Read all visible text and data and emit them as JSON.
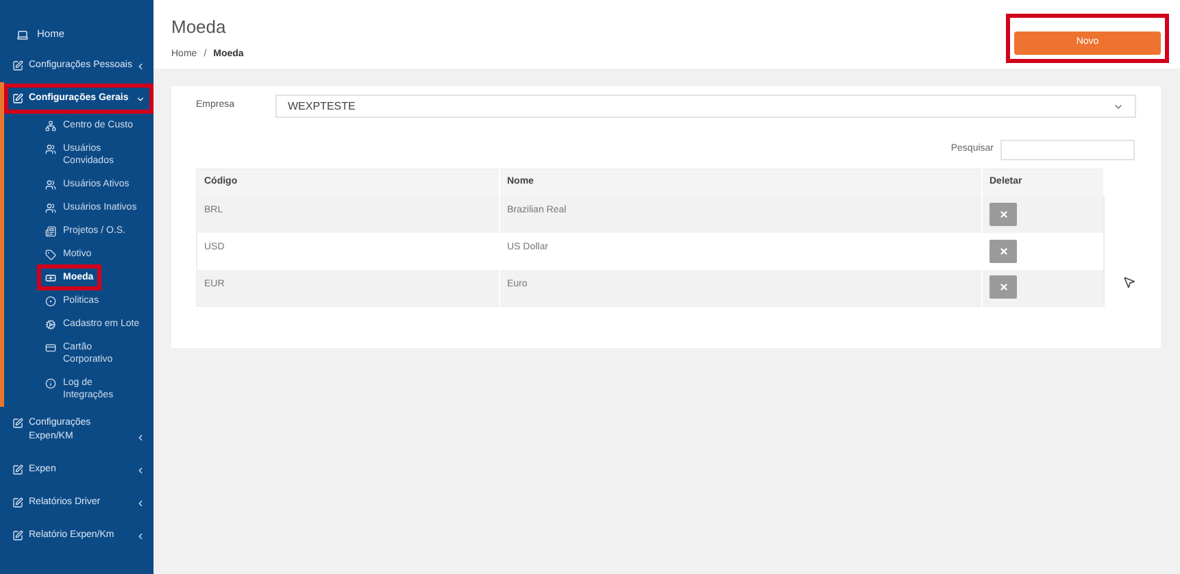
{
  "sidebar": {
    "items": [
      {
        "label": "Home",
        "kind": "link"
      },
      {
        "label": "Configurações Pessoais",
        "kind": "group",
        "expanded": false,
        "highlighted": false
      },
      {
        "label": "Configurações Gerais",
        "kind": "group",
        "expanded": true,
        "highlighted": true,
        "children": [
          {
            "label": "Centro de Custo",
            "selected": false,
            "highlighted": false
          },
          {
            "label": "Usuários Convidados",
            "selected": false,
            "highlighted": false
          },
          {
            "label": "Usuários Ativos",
            "selected": false,
            "highlighted": false
          },
          {
            "label": "Usuários Inativos",
            "selected": false,
            "highlighted": false
          },
          {
            "label": "Projetos / O.S.",
            "selected": false,
            "highlighted": false
          },
          {
            "label": "Motivo",
            "selected": false,
            "highlighted": false
          },
          {
            "label": "Moeda",
            "selected": true,
            "highlighted": true
          },
          {
            "label": "Politicas",
            "selected": false,
            "highlighted": false
          },
          {
            "label": "Cadastro em Lote",
            "selected": false,
            "highlighted": false
          },
          {
            "label": "Cartão Corporativo",
            "selected": false,
            "highlighted": false
          },
          {
            "label": "Log de Integrações",
            "selected": false,
            "highlighted": false
          }
        ]
      },
      {
        "label": "Configurações Expen/KM",
        "kind": "group",
        "expanded": false,
        "highlighted": false
      },
      {
        "label": "Expen",
        "kind": "group",
        "expanded": false,
        "highlighted": false
      },
      {
        "label": "Relatórios Driver",
        "kind": "group",
        "expanded": false,
        "highlighted": false
      },
      {
        "label": "Relatório Expen/Km",
        "kind": "group",
        "expanded": false,
        "highlighted": false
      }
    ]
  },
  "header": {
    "title": "Moeda",
    "breadcrumb": [
      "Home",
      "Moeda"
    ],
    "separator": "/",
    "new_button": {
      "label": "Novo",
      "highlighted": true
    }
  },
  "form": {
    "label": "Empresa",
    "value": "WEXPTESTE"
  },
  "search": {
    "label": "Pesquisar"
  },
  "table": {
    "columns": [
      "Código",
      "Nome",
      "Deletar"
    ],
    "rows": [
      {
        "code": "BRL",
        "name": "Brazilian Real"
      },
      {
        "code": "USD",
        "name": "US Dollar"
      },
      {
        "code": "EUR",
        "name": "Euro"
      }
    ]
  }
}
